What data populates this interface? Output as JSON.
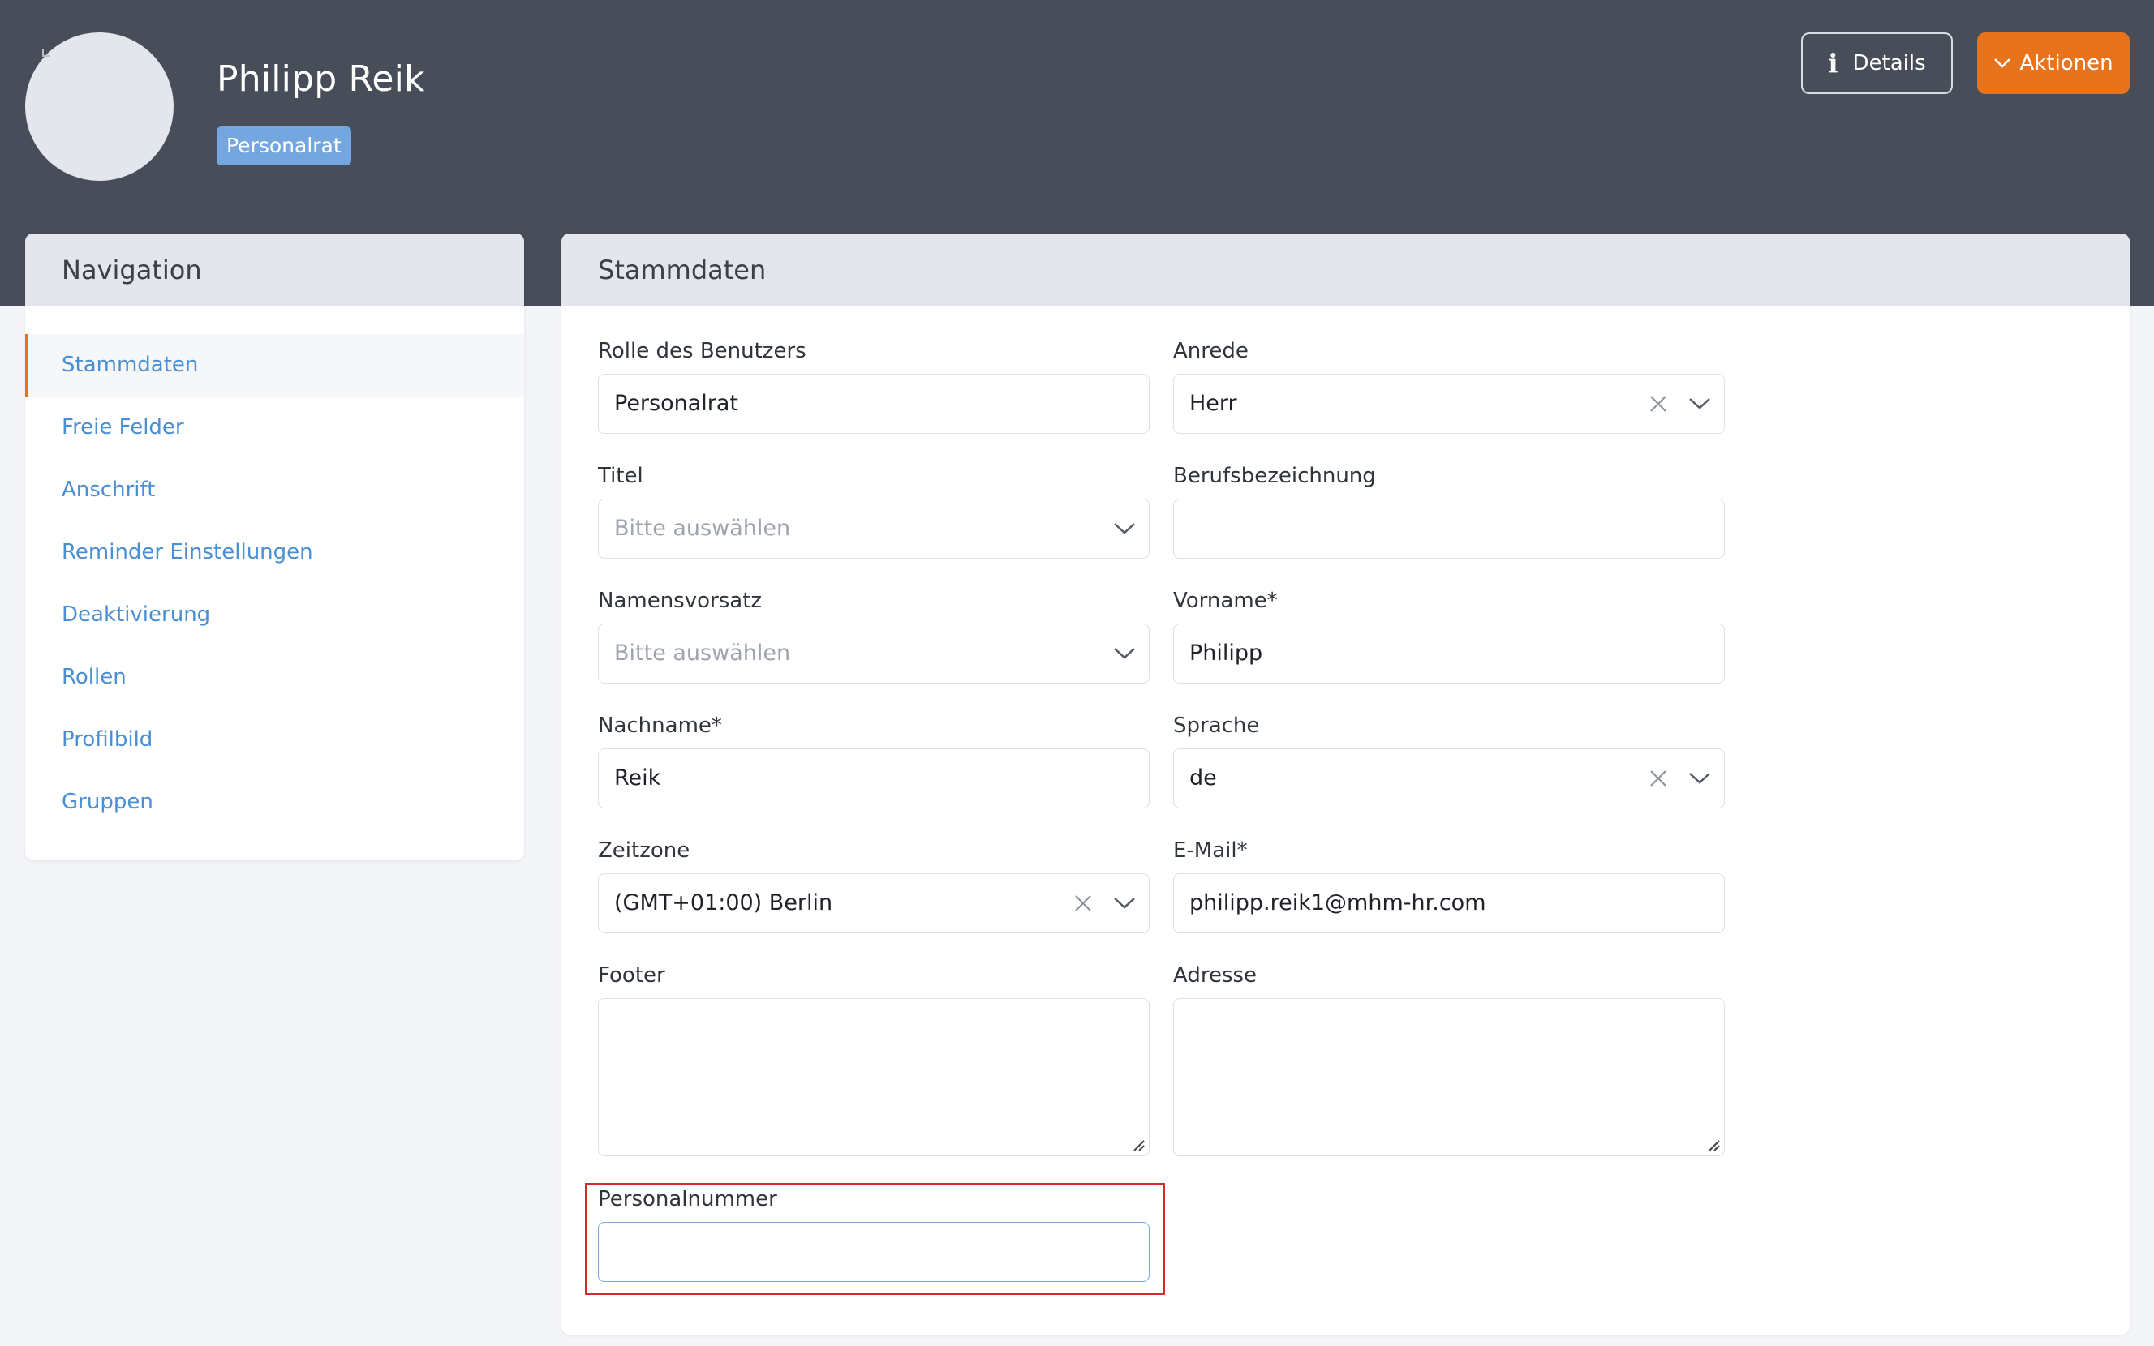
{
  "header": {
    "user_name": "Philipp Reik",
    "role_badge": "Personalrat",
    "details_button": "Details",
    "actions_button": "Aktionen"
  },
  "navigation": {
    "title": "Navigation",
    "items": [
      {
        "label": "Stammdaten",
        "active": true
      },
      {
        "label": "Freie Felder"
      },
      {
        "label": "Anschrift"
      },
      {
        "label": "Reminder Einstellungen"
      },
      {
        "label": "Deaktivierung"
      },
      {
        "label": "Rollen"
      },
      {
        "label": "Profilbild"
      },
      {
        "label": "Gruppen"
      }
    ]
  },
  "form": {
    "title": "Stammdaten",
    "rolle": {
      "label": "Rolle des Benutzers",
      "value": "Personalrat"
    },
    "anrede": {
      "label": "Anrede",
      "value": "Herr"
    },
    "titel": {
      "label": "Titel",
      "placeholder": "Bitte auswählen"
    },
    "berufsbezeichnung": {
      "label": "Berufsbezeichnung",
      "value": ""
    },
    "namensvorsatz": {
      "label": "Namensvorsatz",
      "placeholder": "Bitte auswählen"
    },
    "vorname": {
      "label": "Vorname*",
      "value": "Philipp"
    },
    "nachname": {
      "label": "Nachname*",
      "value": "Reik"
    },
    "sprache": {
      "label": "Sprache",
      "value": "de"
    },
    "zeitzone": {
      "label": "Zeitzone",
      "value": "(GMT+01:00) Berlin"
    },
    "email": {
      "label": "E-Mail*",
      "value": "philipp.reik1@mhm-hr.com"
    },
    "footer": {
      "label": "Footer",
      "value": ""
    },
    "adresse": {
      "label": "Adresse",
      "value": ""
    },
    "personalnummer": {
      "label": "Personalnummer",
      "value": ""
    }
  },
  "colors": {
    "header_bg": "#474e5a",
    "accent_orange": "#e8731d",
    "badge_blue": "#74a6df",
    "nav_link": "#4a8fd2",
    "highlight_red": "#d62b2b"
  },
  "icons": {
    "details": "info-icon",
    "actions": "chevron-down-icon",
    "clear": "close-icon",
    "dropdown": "chevron-down-icon",
    "resize": "resize-grip-icon"
  }
}
